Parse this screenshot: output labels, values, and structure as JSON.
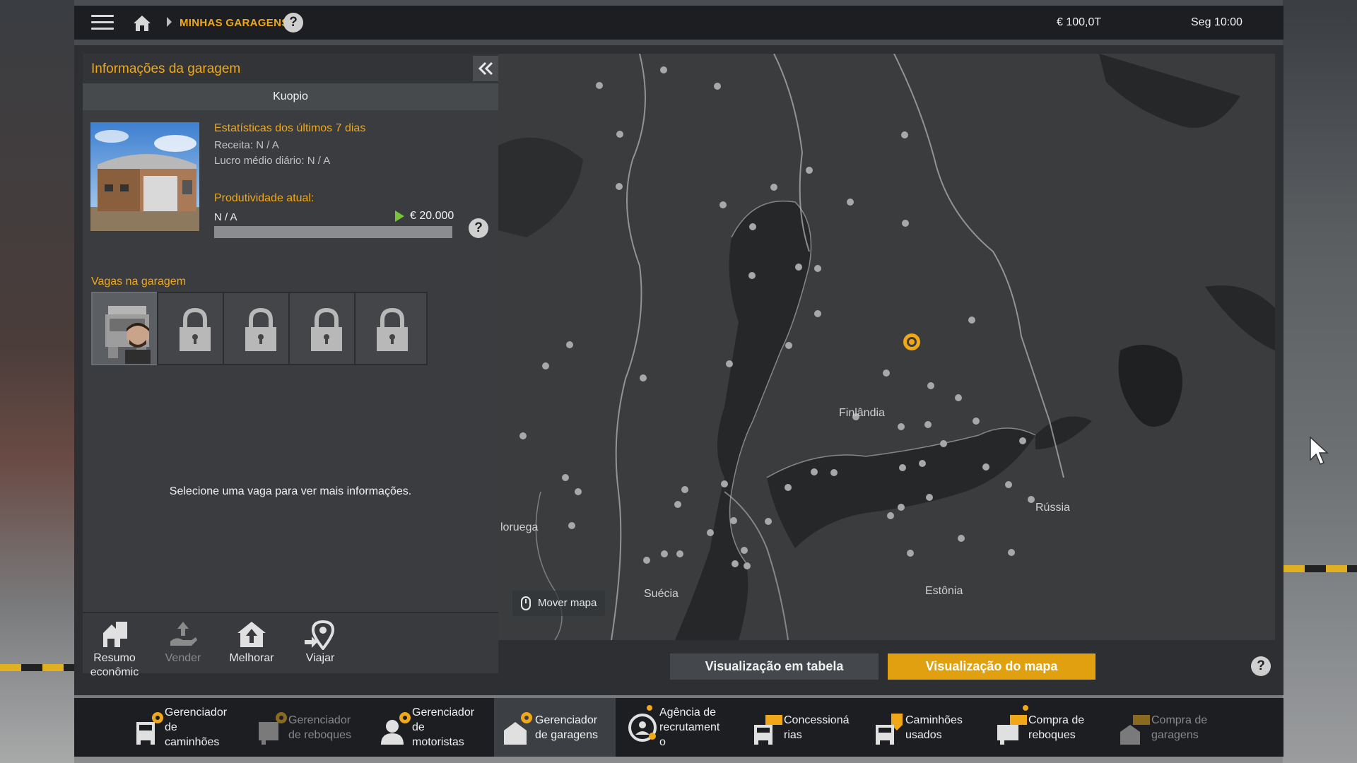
{
  "topbar": {
    "breadcrumb": "MINHAS GARAGENS",
    "money": "€ 100,0T",
    "clock": "Seg 10:00"
  },
  "panel": {
    "title": "Informações da garagem",
    "city": "Kuopio",
    "stats_title": "Estatísticas dos últimos 7 dias",
    "revenue": "Receita: N / A",
    "daily_profit": "Lucro médio diário: N / A",
    "productivity_title": "Produtividade atual:",
    "productivity_value": "N / A",
    "productivity_target": "€ 20.000",
    "productivity_fill": 1.0,
    "slots_title": "Vagas na garagem",
    "slots": [
      {
        "state": "occupied"
      },
      {
        "state": "locked"
      },
      {
        "state": "locked"
      },
      {
        "state": "locked"
      },
      {
        "state": "locked"
      }
    ],
    "empty_message": "Selecione uma vaga para ver mais informações.",
    "actions": [
      {
        "label": "Resumo econômic",
        "enabled": true
      },
      {
        "label": "Vender",
        "enabled": false
      },
      {
        "label": "Melhorar",
        "enabled": true
      },
      {
        "label": "Viajar",
        "enabled": true
      }
    ]
  },
  "map": {
    "labels": {
      "finland": "Finlândia",
      "norway": "loruega",
      "sweden": "Suécia",
      "russia": "Rússia",
      "estonia": "Estônia"
    },
    "move_hint": "Mover mapa",
    "view_table": "Visualização em tabela",
    "view_map": "Visualização do mapa",
    "active_view": "map",
    "accent": "#e0a010"
  },
  "dock": [
    {
      "label": "Gerenciador\nde\ncaminhões",
      "enabled": true,
      "active": false,
      "dot": false
    },
    {
      "label": "Gerenciador\nde reboques",
      "enabled": false,
      "active": false,
      "dot": false
    },
    {
      "label": "Gerenciador\nde\nmotoristas",
      "enabled": true,
      "active": false,
      "dot": false
    },
    {
      "label": "Gerenciador\nde garagens",
      "enabled": true,
      "active": true,
      "dot": false
    },
    {
      "label": "Agência de\nrecrutament\no",
      "enabled": true,
      "active": false,
      "dot": true
    },
    {
      "label": "Concessioná\nrias",
      "enabled": true,
      "active": false,
      "dot": false
    },
    {
      "label": "Caminhões\nusados",
      "enabled": true,
      "active": false,
      "dot": false
    },
    {
      "label": "Compra de\nreboques",
      "enabled": true,
      "active": false,
      "dot": true
    },
    {
      "label": "Compra de\ngaragens",
      "enabled": false,
      "active": false,
      "dot": false
    }
  ]
}
